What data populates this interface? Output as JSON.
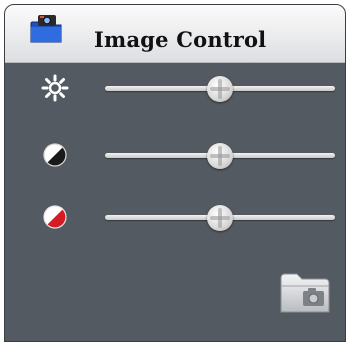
{
  "panel": {
    "title": "Image Control",
    "header_icon": "camera-folder-icon"
  },
  "controls": [
    {
      "name": "brightness",
      "icon": "brightness-sun-icon",
      "level": 0.5
    },
    {
      "name": "contrast",
      "icon": "contrast-circle-icon",
      "level": 0.5
    },
    {
      "name": "saturation",
      "icon": "saturation-circle-icon",
      "level": 0.5
    }
  ],
  "footer": {
    "button_icon": "photo-folder-icon"
  },
  "colors": {
    "panel_background": "#545a61",
    "header_background": "#e9eaec",
    "saturation_accent": "#d41c24"
  }
}
